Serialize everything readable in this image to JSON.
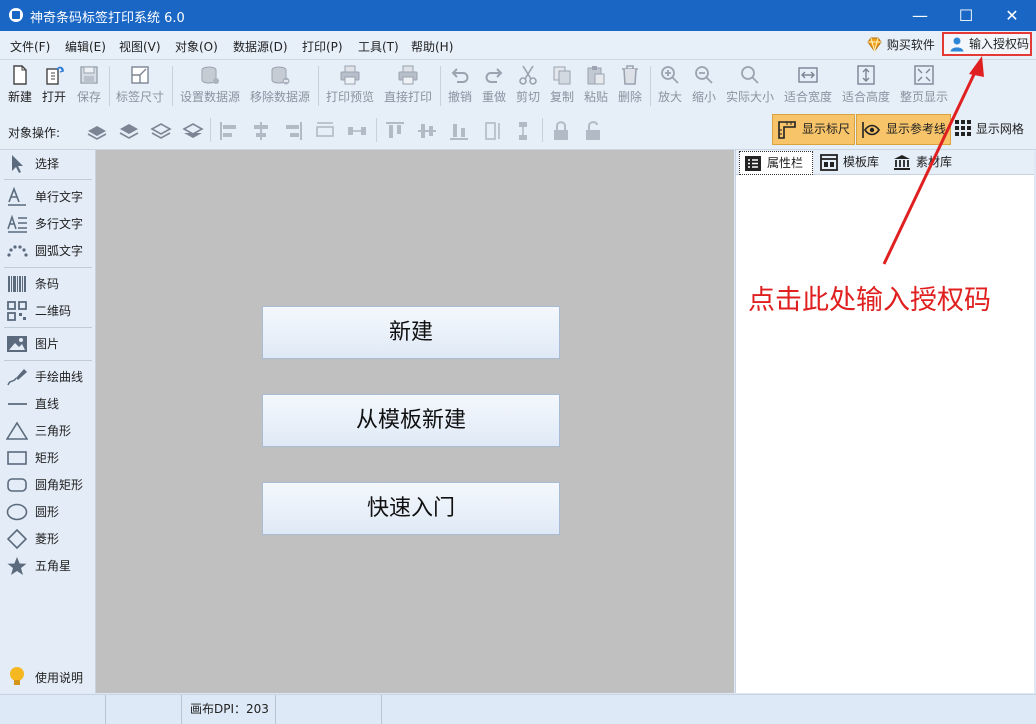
{
  "window": {
    "title": "神奇条码标签打印系统 6.0"
  },
  "menu": [
    "文件(F)",
    "编辑(E)",
    "视图(V)",
    "对象(O)",
    "数据源(D)",
    "打印(P)",
    "工具(T)",
    "帮助(H)"
  ],
  "menu_right": {
    "buy": "购买软件",
    "auth": "输入授权码"
  },
  "toolbar": [
    {
      "label": "新建",
      "icon": "new-icon"
    },
    {
      "label": "打开",
      "icon": "open-icon"
    },
    {
      "label": "保存",
      "icon": "save-icon"
    },
    {
      "label": "标签尺寸",
      "icon": "label-size-icon"
    },
    {
      "label": "设置数据源",
      "icon": "set-datasource-icon"
    },
    {
      "label": "移除数据源",
      "icon": "remove-datasource-icon"
    },
    {
      "label": "打印预览",
      "icon": "print-preview-icon"
    },
    {
      "label": "直接打印",
      "icon": "print-icon"
    },
    {
      "label": "撤销",
      "icon": "undo-icon"
    },
    {
      "label": "重做",
      "icon": "redo-icon"
    },
    {
      "label": "剪切",
      "icon": "cut-icon"
    },
    {
      "label": "复制",
      "icon": "copy-icon"
    },
    {
      "label": "粘贴",
      "icon": "paste-icon"
    },
    {
      "label": "删除",
      "icon": "delete-icon"
    },
    {
      "label": "放大",
      "icon": "zoom-in-icon"
    },
    {
      "label": "缩小",
      "icon": "zoom-out-icon"
    },
    {
      "label": "实际大小",
      "icon": "actual-size-icon"
    },
    {
      "label": "适合宽度",
      "icon": "fit-width-icon"
    },
    {
      "label": "适合高度",
      "icon": "fit-height-icon"
    },
    {
      "label": "整页显示",
      "icon": "fit-page-icon"
    }
  ],
  "object_ops": {
    "label": "对象操作:",
    "show_ruler": "显示标尺",
    "show_guides": "显示参考线",
    "show_grid": "显示网格"
  },
  "sidebar": [
    {
      "label": "选择",
      "icon": "select-cursor-icon"
    },
    {
      "label": "单行文字",
      "icon": "single-line-text-icon"
    },
    {
      "label": "多行文字",
      "icon": "multi-line-text-icon"
    },
    {
      "label": "圆弧文字",
      "icon": "arc-text-icon"
    },
    {
      "label": "条码",
      "icon": "barcode-icon"
    },
    {
      "label": "二维码",
      "icon": "qrcode-icon"
    },
    {
      "label": "图片",
      "icon": "image-icon"
    },
    {
      "label": "手绘曲线",
      "icon": "freehand-icon"
    },
    {
      "label": "直线",
      "icon": "line-icon"
    },
    {
      "label": "三角形",
      "icon": "triangle-icon"
    },
    {
      "label": "矩形",
      "icon": "rectangle-icon"
    },
    {
      "label": "圆角矩形",
      "icon": "rounded-rect-icon"
    },
    {
      "label": "圆形",
      "icon": "ellipse-icon"
    },
    {
      "label": "菱形",
      "icon": "diamond-icon"
    },
    {
      "label": "五角星",
      "icon": "star-icon"
    }
  ],
  "sidebar_help": "使用说明",
  "canvas_buttons": [
    "新建",
    "从模板新建",
    "快速入门"
  ],
  "right_tabs": [
    "属性栏",
    "模板库",
    "素材库"
  ],
  "annotation": "点击此处输入授权码",
  "status": {
    "dpi": "画布DPI：203"
  },
  "colors": {
    "titlebar": "#1a66c4",
    "annotation": "#e02020",
    "toggle": "#f7c46a"
  }
}
